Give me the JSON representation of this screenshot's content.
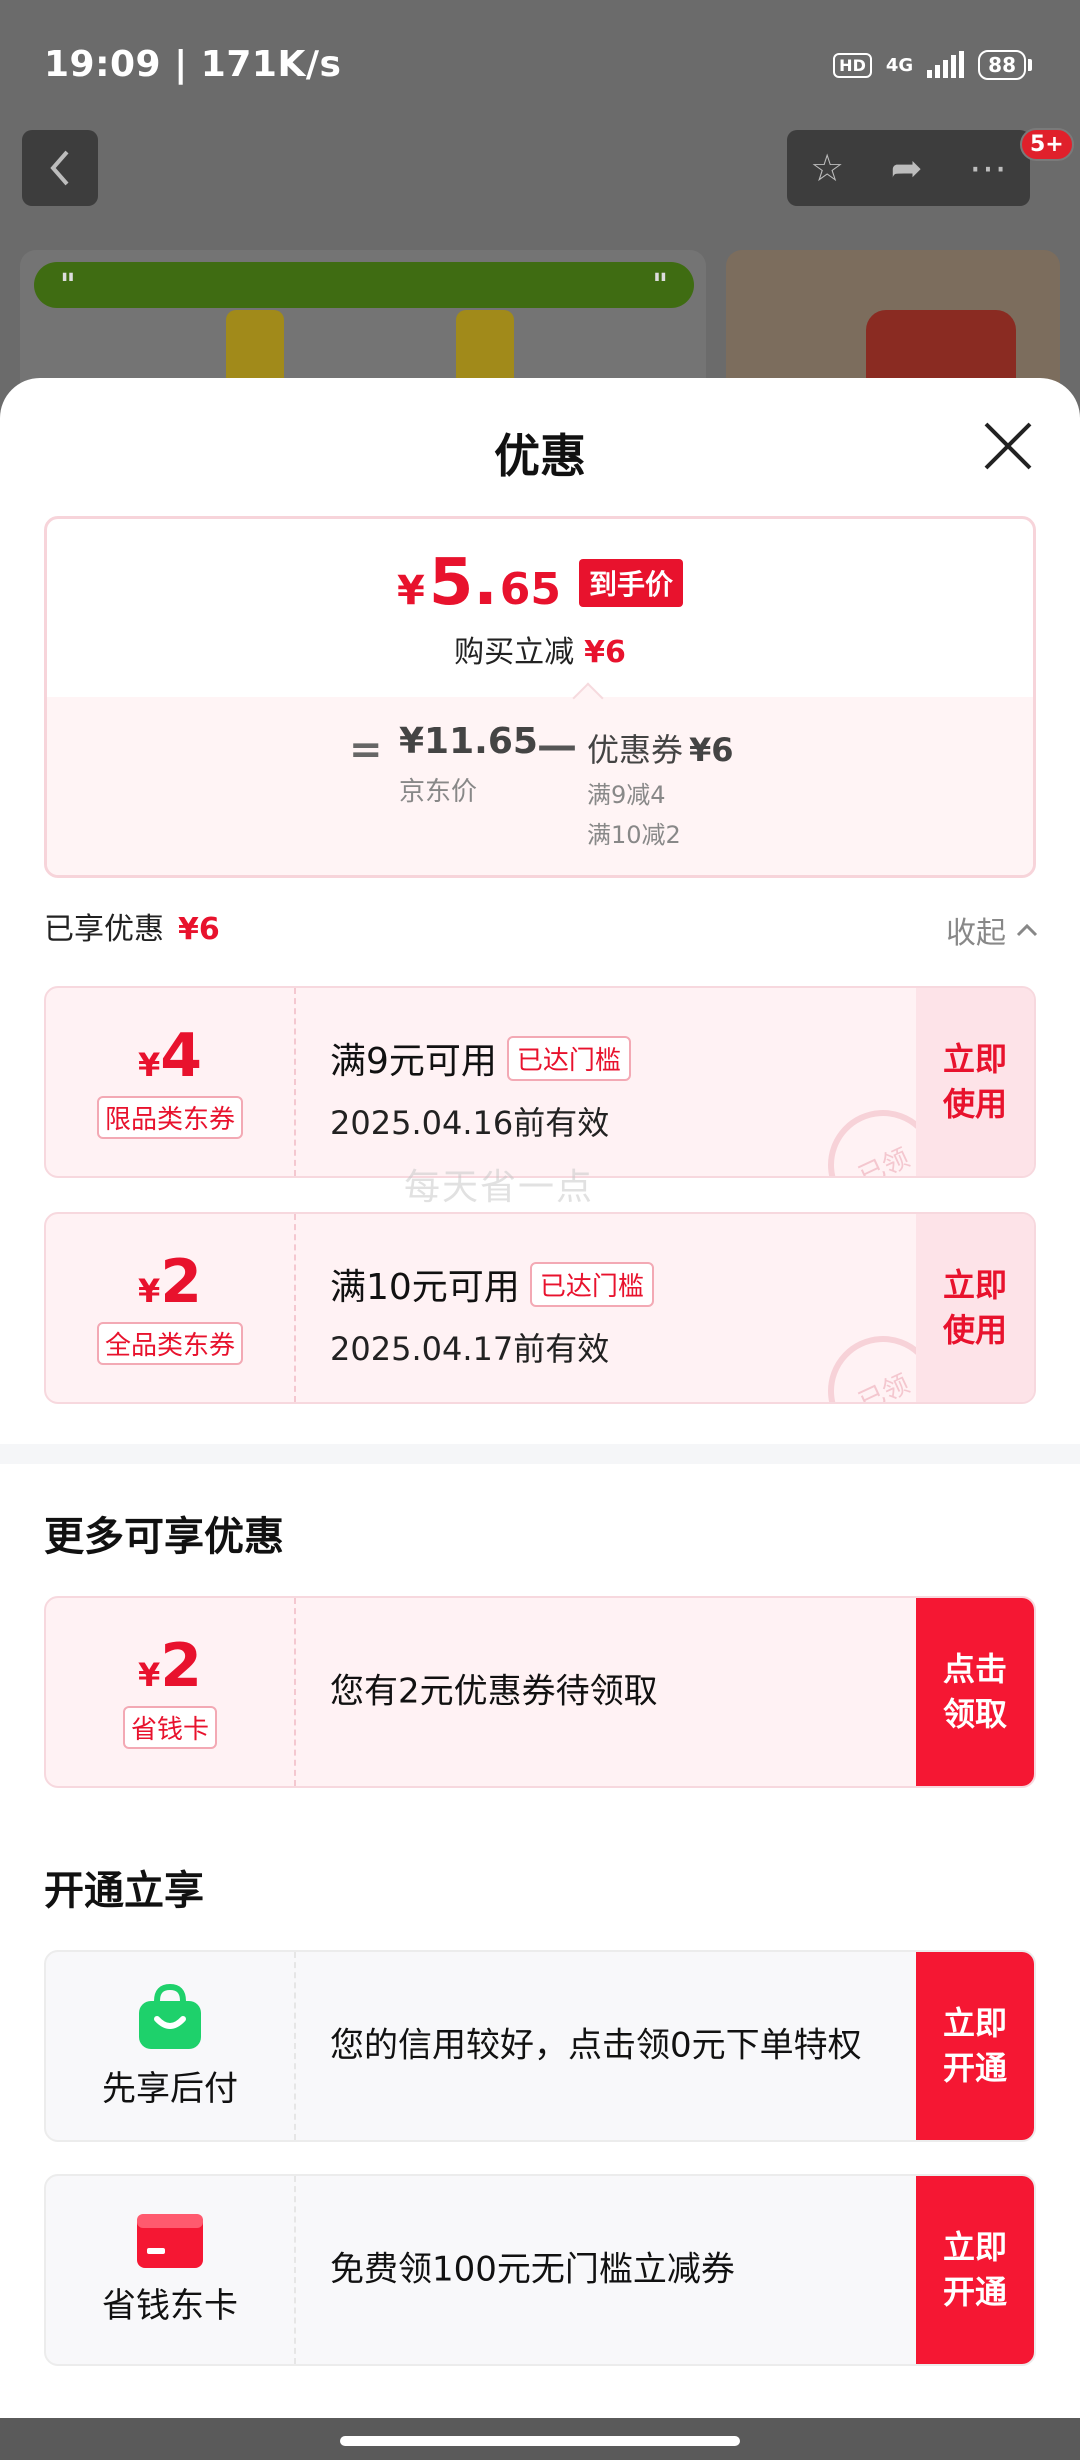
{
  "status_bar": {
    "time_speed": "19:09 | 171K/s",
    "hd": "HD",
    "network": "4G",
    "battery": "88"
  },
  "background_page": {
    "cart_badge": "5+",
    "banner_open_quote": "\"",
    "banner_close_quote": "\""
  },
  "sheet": {
    "title": "优惠",
    "price_summary": {
      "final_yen": "¥",
      "final_int": "5.",
      "final_dec": "65",
      "final_tag": "到手价",
      "buy_reduce_label": "购买立减",
      "buy_reduce_value": "¥6",
      "equals": "=",
      "jd_price": "¥11.65",
      "jd_label": "京东价",
      "minus": "—",
      "coupon_label": "优惠券",
      "coupon_value": "¥6",
      "coupon_detail_1": "满9减4",
      "coupon_detail_2": "满10减2"
    },
    "enjoyed": {
      "label": "已享优惠",
      "value": "¥6",
      "collapse_label": "收起"
    },
    "coupons": [
      {
        "yen": "¥",
        "amount": "4",
        "type": "限品类东券",
        "condition": "满9元可用",
        "reached": "已达门槛",
        "valid": "2025.04.16前有效",
        "button": "立即\n使用",
        "stamp": "已领"
      },
      {
        "yen": "¥",
        "amount": "2",
        "type": "全品类东券",
        "condition": "满10元可用",
        "reached": "已达门槛",
        "valid": "2025.04.17前有效",
        "button": "立即\n使用",
        "stamp": "已领"
      }
    ],
    "watermark": "每天省一点",
    "more": {
      "title": "更多可享优惠",
      "card": {
        "yen": "¥",
        "amount": "2",
        "type": "省钱卡",
        "text": "您有2元优惠券待领取",
        "button": "点击\n领取"
      }
    },
    "open": {
      "title": "开通立享",
      "cards": [
        {
          "name": "先享后付",
          "icon": "shopping-bag-icon",
          "text": "您的信用较好，点击领0元下单特权",
          "button": "立即\n开通"
        },
        {
          "name": "省钱东卡",
          "icon": "card-icon",
          "text": "免费领100元无门槛立减券",
          "button": "立即\n开通"
        }
      ]
    }
  },
  "colors": {
    "accent_red": "#e8122d",
    "button_red": "#f51733",
    "pay_green": "#1ed16b"
  }
}
